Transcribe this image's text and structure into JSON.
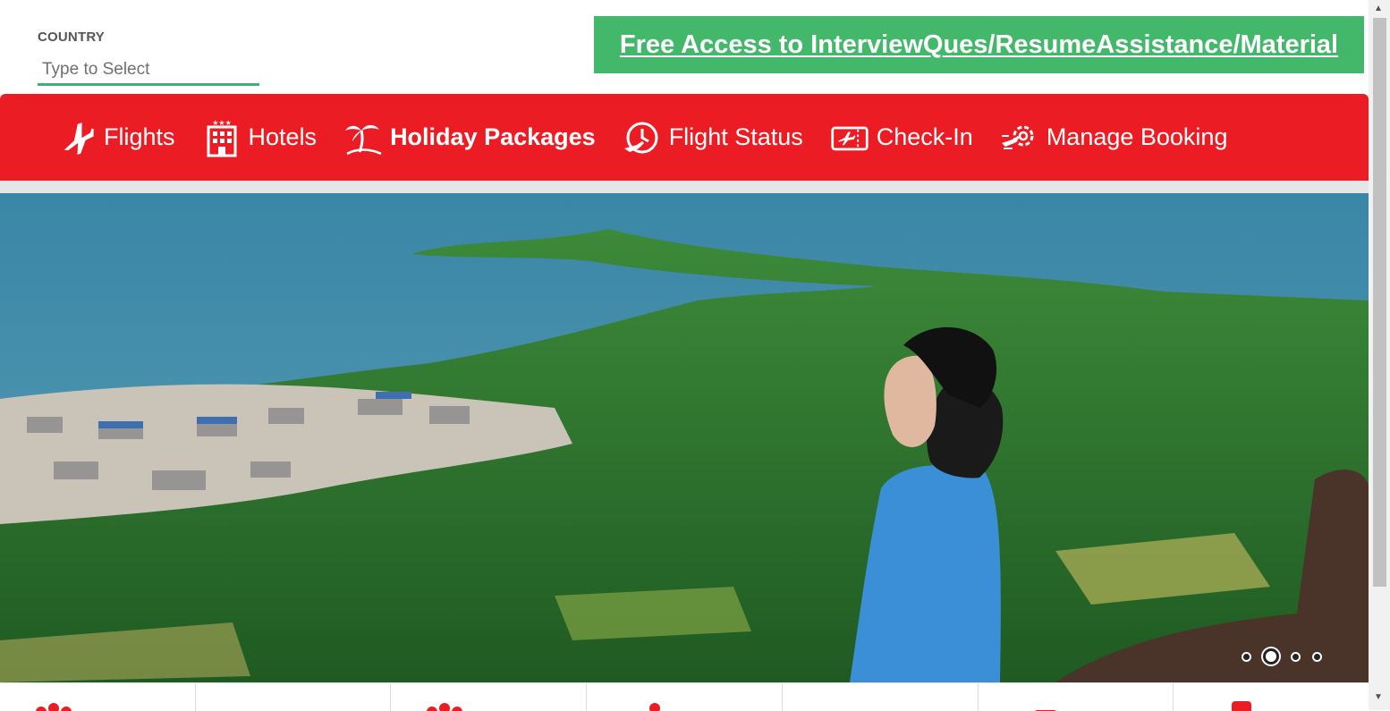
{
  "country": {
    "label": "COUNTRY",
    "placeholder": "Type to Select"
  },
  "promo": {
    "text": "Free Access to InterviewQues/ResumeAssistance/Material"
  },
  "nav": {
    "items": [
      {
        "label": "Flights",
        "icon": "airplane-icon"
      },
      {
        "label": "Hotels",
        "icon": "hotel-building-icon"
      },
      {
        "label": "Holiday Packages",
        "icon": "palm-tree-icon",
        "active": true
      },
      {
        "label": "Flight Status",
        "icon": "clock-plane-icon"
      },
      {
        "label": "Check-In",
        "icon": "boarding-pass-icon"
      },
      {
        "label": "Manage Booking",
        "icon": "gear-plane-icon"
      }
    ]
  },
  "carousel": {
    "slide_count": 4,
    "active_index": 1
  },
  "colors": {
    "brand_red": "#ec1c24",
    "promo_green": "#43b76a",
    "input_underline": "#3cb371"
  },
  "scrollbar": {
    "up": "▲",
    "down": "▼"
  }
}
